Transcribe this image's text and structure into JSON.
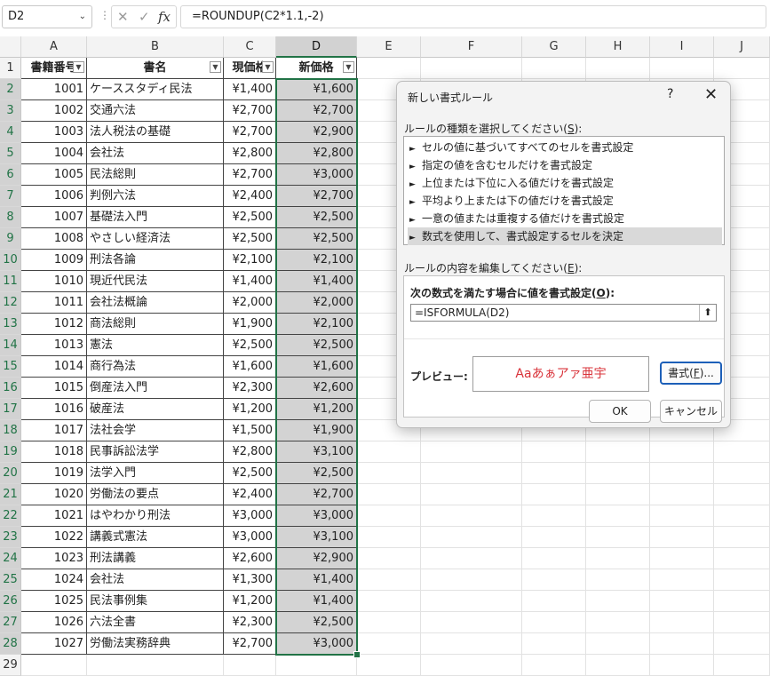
{
  "formula_bar": {
    "name_box": "D2",
    "formula": "=ROUNDUP(C2*1.1,-2)",
    "cancel_glyph": "✕",
    "enter_glyph": "✓",
    "fx_glyph": "fx",
    "sep_glyph": "⋮",
    "dd_glyph": "⌄"
  },
  "columns": [
    "A",
    "B",
    "C",
    "D",
    "E",
    "F",
    "G",
    "H",
    "I",
    "J"
  ],
  "header_row": {
    "a": "書籍番号",
    "b": "書名",
    "c": "現価格",
    "d": "新価格",
    "filter_glyph": "▼"
  },
  "rows": [
    {
      "n": "2",
      "a": "1001",
      "b": "ケーススタディ民法",
      "c": "¥1,400",
      "d": "¥1,600"
    },
    {
      "n": "3",
      "a": "1002",
      "b": "交通六法",
      "c": "¥2,700",
      "d": "¥2,700"
    },
    {
      "n": "4",
      "a": "1003",
      "b": "法人税法の基礎",
      "c": "¥2,700",
      "d": "¥2,900"
    },
    {
      "n": "5",
      "a": "1004",
      "b": "会社法",
      "c": "¥2,800",
      "d": "¥2,800"
    },
    {
      "n": "6",
      "a": "1005",
      "b": "民法総則",
      "c": "¥2,700",
      "d": "¥3,000"
    },
    {
      "n": "7",
      "a": "1006",
      "b": "判例六法",
      "c": "¥2,400",
      "d": "¥2,700"
    },
    {
      "n": "8",
      "a": "1007",
      "b": "基礎法入門",
      "c": "¥2,500",
      "d": "¥2,500"
    },
    {
      "n": "9",
      "a": "1008",
      "b": "やさしい経済法",
      "c": "¥2,500",
      "d": "¥2,500"
    },
    {
      "n": "10",
      "a": "1009",
      "b": "刑法各論",
      "c": "¥2,100",
      "d": "¥2,100"
    },
    {
      "n": "11",
      "a": "1010",
      "b": "現近代民法",
      "c": "¥1,400",
      "d": "¥1,400"
    },
    {
      "n": "12",
      "a": "1011",
      "b": "会社法概論",
      "c": "¥2,000",
      "d": "¥2,000"
    },
    {
      "n": "13",
      "a": "1012",
      "b": "商法総則",
      "c": "¥1,900",
      "d": "¥2,100"
    },
    {
      "n": "14",
      "a": "1013",
      "b": "憲法",
      "c": "¥2,500",
      "d": "¥2,500"
    },
    {
      "n": "15",
      "a": "1014",
      "b": "商行為法",
      "c": "¥1,600",
      "d": "¥1,600"
    },
    {
      "n": "16",
      "a": "1015",
      "b": "倒産法入門",
      "c": "¥2,300",
      "d": "¥2,600"
    },
    {
      "n": "17",
      "a": "1016",
      "b": "破産法",
      "c": "¥1,200",
      "d": "¥1,200"
    },
    {
      "n": "18",
      "a": "1017",
      "b": "法社会学",
      "c": "¥1,500",
      "d": "¥1,900"
    },
    {
      "n": "19",
      "a": "1018",
      "b": "民事訴訟法学",
      "c": "¥2,800",
      "d": "¥3,100"
    },
    {
      "n": "20",
      "a": "1019",
      "b": "法学入門",
      "c": "¥2,500",
      "d": "¥2,500"
    },
    {
      "n": "21",
      "a": "1020",
      "b": "労働法の要点",
      "c": "¥2,400",
      "d": "¥2,700"
    },
    {
      "n": "22",
      "a": "1021",
      "b": "はやわかり刑法",
      "c": "¥3,000",
      "d": "¥3,000"
    },
    {
      "n": "23",
      "a": "1022",
      "b": "講義式憲法",
      "c": "¥3,000",
      "d": "¥3,100"
    },
    {
      "n": "24",
      "a": "1023",
      "b": "刑法講義",
      "c": "¥2,600",
      "d": "¥2,900"
    },
    {
      "n": "25",
      "a": "1024",
      "b": "会社法",
      "c": "¥1,300",
      "d": "¥1,400"
    },
    {
      "n": "26",
      "a": "1025",
      "b": "民法事例集",
      "c": "¥1,200",
      "d": "¥1,400"
    },
    {
      "n": "27",
      "a": "1026",
      "b": "六法全書",
      "c": "¥2,300",
      "d": "¥2,500"
    },
    {
      "n": "28",
      "a": "1027",
      "b": "労働法実務辞典",
      "c": "¥2,700",
      "d": "¥3,000"
    },
    {
      "n": "29",
      "a": "",
      "b": "",
      "c": "",
      "d": ""
    }
  ],
  "dialog": {
    "title": "新しい書式ルール",
    "help": "?",
    "close": "✕",
    "rule_type_label": "ルールの種類を選択してください(",
    "rule_type_key": "S",
    "rule_type_tail": "):",
    "rule_types": [
      "セルの値に基づいてすべてのセルを書式設定",
      "指定の値を含むセルだけを書式設定",
      "上位または下位に入る値だけを書式設定",
      "平均より上または下の値だけを書式設定",
      "一意の値または重複する値だけを書式設定",
      "数式を使用して、書式設定するセルを決定"
    ],
    "rule_arrow": "►",
    "edit_label": "ルールの内容を編集してください(",
    "edit_key": "E",
    "edit_tail": "):",
    "condition_label": "次の数式を満たす場合に値を書式設定(",
    "condition_key": "O",
    "condition_tail": "):",
    "formula": "=ISFORMULA(D2)",
    "collapse_glyph": "⬆",
    "preview_label": "プレビュー:",
    "preview_text": "Aaあぁアァ亜宇",
    "preview_color": "#d9343b",
    "format_button_head": "書式(",
    "format_button_key": "F",
    "format_button_tail": ")...",
    "ok": "OK",
    "cancel": "キャンセル"
  },
  "colors": {
    "selection": "#217346",
    "shade": "#d3d3d3",
    "accent": "#1c5fb8"
  }
}
